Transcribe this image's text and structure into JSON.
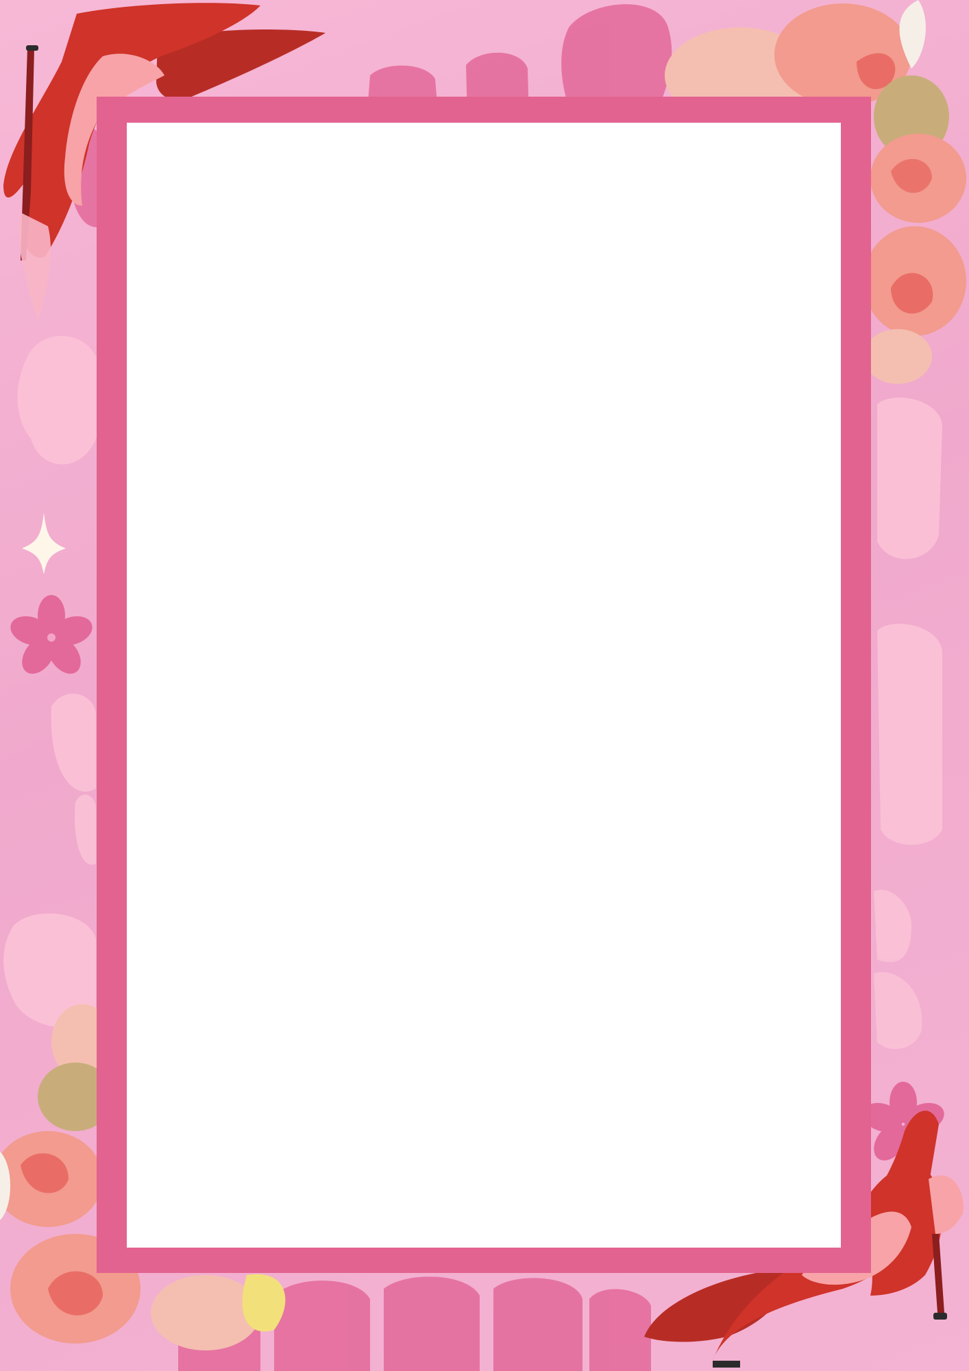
{
  "colors": {
    "background": "#f4b3d3",
    "frame": "#e2638f",
    "card": "#ffffff",
    "blob_dark": "#e3699a",
    "blob_light": "#fbc3d6",
    "shoe": "#cf3329",
    "shoe_dark": "#b72d26",
    "shoe_inner": "#f7a3a8",
    "rose": "#f29b8e",
    "rose_deep": "#e55a55",
    "sparkle": "#fff6ea"
  },
  "decorations": {
    "shoes": [
      "red-high-heel-shoe-top-left",
      "red-high-heel-shoe-bottom-right"
    ],
    "roses": [
      "rose-cluster-top-right",
      "rose-cluster-bottom-left"
    ],
    "flowers": [
      "pink-flower-left",
      "pink-flower-bottom-right"
    ],
    "sparkle": "sparkle-star-left"
  }
}
